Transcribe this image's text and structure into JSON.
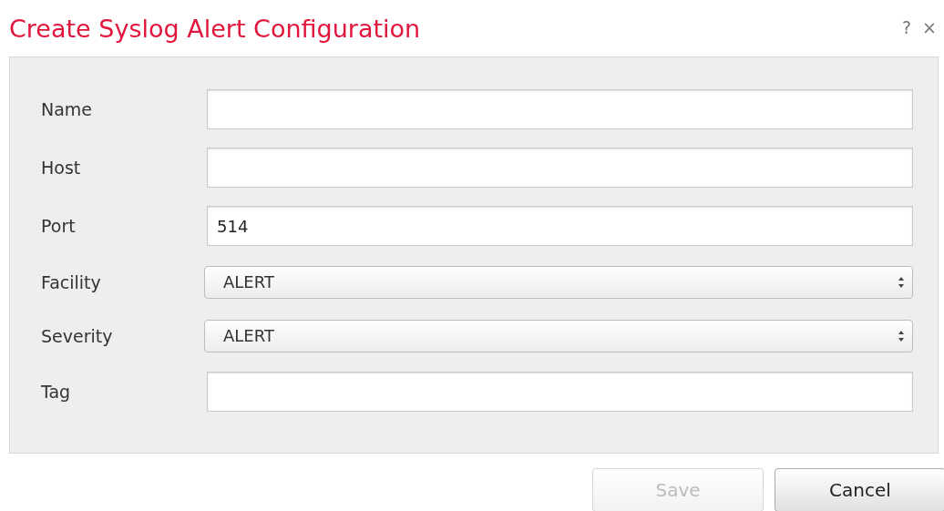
{
  "window": {
    "title": "Create Syslog Alert Configuration",
    "help": "?",
    "close": "×"
  },
  "fields": [
    {
      "label": "Name",
      "kind": "text"
    },
    {
      "label": "Host",
      "kind": "text"
    },
    {
      "label": "Port",
      "kind": "text",
      "value": "514"
    },
    {
      "label": "Facility",
      "kind": "select",
      "value": "ALERT"
    },
    {
      "label": "Severity",
      "kind": "select",
      "value": "ALERT"
    },
    {
      "label": "Tag",
      "kind": "text"
    }
  ],
  "buttons": [
    {
      "label": "Save",
      "disabled": true
    },
    {
      "label": "Cancel",
      "disabled": false
    }
  ]
}
